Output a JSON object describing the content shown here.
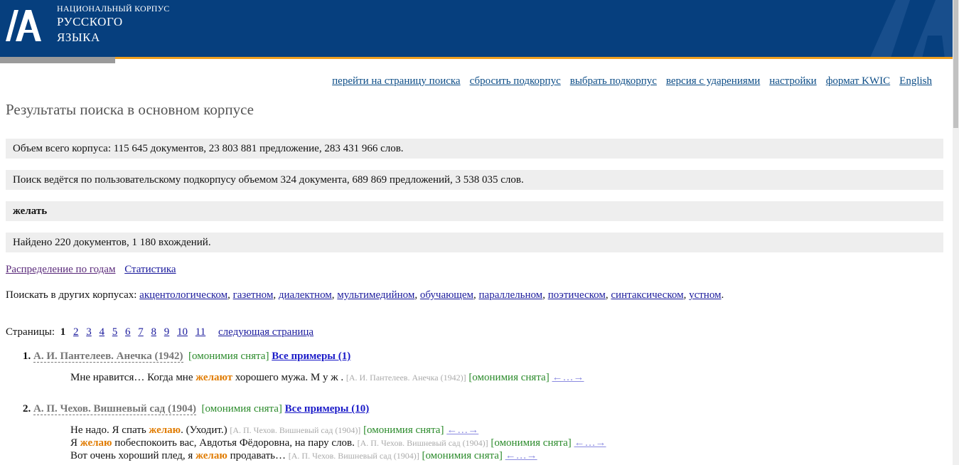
{
  "header": {
    "logo_line1": "НАЦИОНАЛЬНЫЙ КОРПУС",
    "logo_line2": "РУССКОГО",
    "logo_line3": "ЯЗЫКА"
  },
  "nav": {
    "items": [
      "перейти на страницу поиска",
      "сбросить подкорпус",
      "выбрать подкорпус",
      "версия с ударениями",
      "настройки",
      "формат KWIC",
      "English"
    ]
  },
  "page_title": "Результаты поиска в основном корпусе",
  "info": {
    "corpus_size": "Объем всего корпуса: 115 645 документов, 23 803 881 предложение, 283 431 966 слов.",
    "subcorpus": "Поиск ведётся по пользовательскому подкорпусу объемом 324 документа, 689 869 предложений, 3 538 035 слов.",
    "query": "желать",
    "found": "Найдено 220 документов, 1 180 вхождений."
  },
  "links": {
    "distribution": "Распределение по годам",
    "statistics": "Статистика"
  },
  "other_corpora": {
    "label": "Поискать в других корпусах:",
    "items": [
      "акцентологическом",
      "газетном",
      "диалектном",
      "мультимедийном",
      "обучающем",
      "параллельном",
      "поэтическом",
      "синтаксическом",
      "устном"
    ]
  },
  "pagination": {
    "label": "Страницы:",
    "current": "1",
    "pages": [
      "2",
      "3",
      "4",
      "5",
      "6",
      "7",
      "8",
      "9",
      "10",
      "11"
    ],
    "next": "следующая страница"
  },
  "common": {
    "homonymy": "[омонимия снята]",
    "ctx_arrows": "←…→"
  },
  "results": [
    {
      "num": "1.",
      "title": "А. И. Пантелеев. Анечка (1942)",
      "all_examples": "Все примеры (1)",
      "examples": [
        {
          "before": "Мне нравится… Когда мне ",
          "hit": "желают",
          "after": " хорошего мужа. М  у  ж   .",
          "source": "[А. И. Пантелеев. Анечка (1942)]"
        }
      ]
    },
    {
      "num": "2.",
      "title": "А. П. Чехов. Вишневый сад (1904)",
      "all_examples": "Все примеры (10)",
      "examples": [
        {
          "before": "Не надо. Я спать ",
          "hit": "желаю",
          "after": ". (Уходит.)",
          "source": "[А. П. Чехов. Вишневый сад (1904)]"
        },
        {
          "before": "Я ",
          "hit": "желаю",
          "after": " побеспокоить вас, Авдотья Фёдоровна, на пару слов.",
          "source": "[А. П. Чехов. Вишневый сад (1904)]"
        },
        {
          "before": "Вот очень хороший плед, я ",
          "hit": "желаю",
          "after": " продавать…",
          "source": "[А. П. Чехов. Вишневый сад (1904)]"
        }
      ]
    }
  ]
}
